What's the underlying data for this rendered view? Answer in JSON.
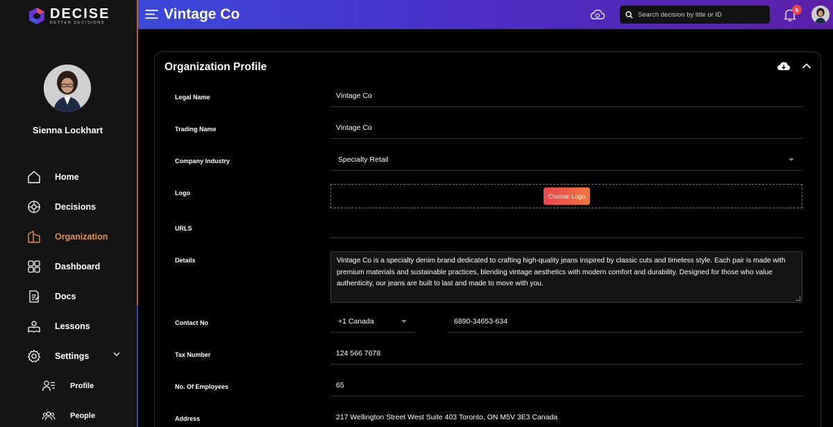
{
  "brand": {
    "name": "DECISE",
    "tagline": "BETTER DECISIONS"
  },
  "user": {
    "name": "Sienna Lockhart"
  },
  "sidebar": {
    "items": [
      {
        "label": "Home",
        "icon": "home-icon"
      },
      {
        "label": "Decisions",
        "icon": "decisions-icon"
      },
      {
        "label": "Organization",
        "icon": "organization-icon",
        "active": true
      },
      {
        "label": "Dashboard",
        "icon": "dashboard-icon"
      },
      {
        "label": "Docs",
        "icon": "docs-icon"
      },
      {
        "label": "Lessons",
        "icon": "lessons-icon"
      },
      {
        "label": "Settings",
        "icon": "gear-icon",
        "expanded": true
      }
    ],
    "sub_items": [
      {
        "label": "Profile",
        "icon": "profile-icon"
      },
      {
        "label": "People",
        "icon": "people-icon"
      }
    ]
  },
  "header": {
    "title": "Vintage Co",
    "search_placeholder": "Search decision by title or ID",
    "notification_count": "5"
  },
  "card": {
    "title": "Organization Profile",
    "fields": {
      "legal_name": {
        "label": "Legal Name",
        "value": "Vintage Co"
      },
      "trading_name": {
        "label": "Trading Name",
        "value": "Vintage Co"
      },
      "industry": {
        "label": "Company Industry",
        "value": "Specialty Retail"
      },
      "logo": {
        "label": "Logo",
        "button": "Choose Logo"
      },
      "urls": {
        "label": "URLS",
        "value": ""
      },
      "details": {
        "label": "Details",
        "value": "Vintage Co is a specialty denim brand dedicated to crafting high-quality jeans inspired by classic cuts and timeless style. Each pair is made with premium materials and sustainable practices, blending vintage aesthetics with modern comfort and durability. Designed for those who value authenticity, our jeans are built to last and made to move with you."
      },
      "contact": {
        "label": "Contact No",
        "country_code": "+1 Canada",
        "number": "6890-34653-634"
      },
      "tax": {
        "label": "Tax Number",
        "value": "124 566 7678"
      },
      "employees": {
        "label": "No. Of Employees",
        "value": "65"
      },
      "address": {
        "label": "Address",
        "value": "217 Wellington Street West Suite 403 Toronto, ON M5V 3E3 Canada"
      }
    }
  },
  "colors": {
    "accent": "#e0915a",
    "header_start": "#3b49d8",
    "header_end": "#5b1fa8",
    "button": "#e8474e"
  }
}
